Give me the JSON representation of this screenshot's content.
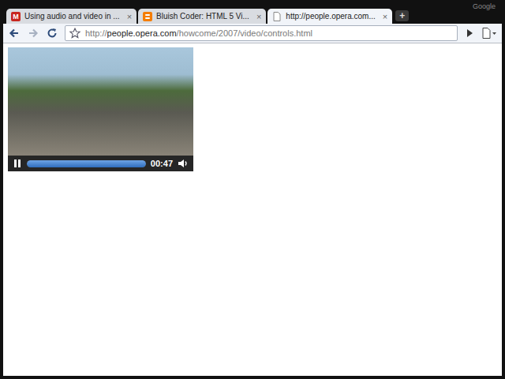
{
  "window": {
    "corner_text": "Google"
  },
  "tabs": [
    {
      "label": "Using audio and video in ...",
      "selected": false,
      "favicon": "M",
      "close": "×"
    },
    {
      "label": "Bluish Coder: HTML 5 Vi...",
      "selected": false,
      "favicon": "",
      "close": "×"
    },
    {
      "label": "http://people.opera.com...",
      "selected": true,
      "favicon": "",
      "close": "×"
    }
  ],
  "new_tab": "+",
  "nav": {
    "back_enabled": true,
    "forward_enabled": false
  },
  "address": {
    "scheme": "http://",
    "host": "people.opera.com",
    "path": "/howcome/2007/video/controls.html"
  },
  "video": {
    "playing": true,
    "time": "00:47",
    "level": 1,
    "muted": false
  }
}
